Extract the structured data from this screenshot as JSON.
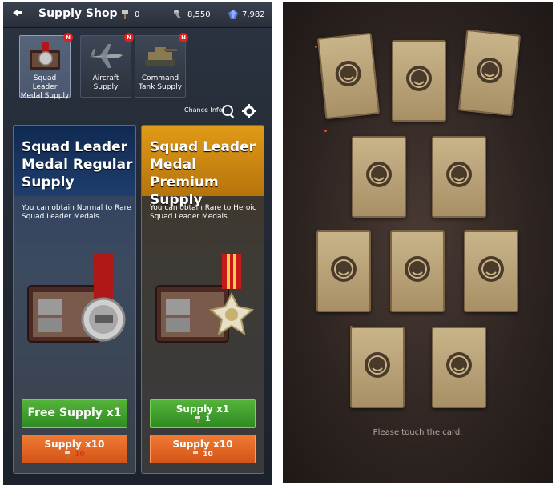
{
  "header": {
    "title": "Supply Shop",
    "resources": [
      {
        "icon": "hammer-icon",
        "value": "0"
      },
      {
        "icon": "wrench-icon",
        "value": "8,550"
      },
      {
        "icon": "gem-icon",
        "value": "7,982"
      }
    ]
  },
  "tabs": [
    {
      "label": "Squad Leader\nMedal Supply",
      "badge": "N",
      "icon": "medal-case-icon"
    },
    {
      "label": "Aircraft\nSupply",
      "badge": "N",
      "icon": "aircraft-icon"
    },
    {
      "label": "Command\nTank Supply",
      "badge": "N",
      "icon": "tank-icon"
    }
  ],
  "chance_info": "Chance Info",
  "cards": {
    "regular": {
      "title": "Squad Leader Medal Regular Supply",
      "description": "You can obtain Normal to Rare Squad Leader Medals.",
      "free_label": "Free Supply x1",
      "x10_label": "Supply x10",
      "x10_cost": "10"
    },
    "premium": {
      "title": "Squad Leader Medal Premium Supply",
      "description": "You can obtain Rare to Heroic Squad Leader Medals.",
      "x1_label": "Supply x1",
      "x1_cost": "1",
      "x10_label": "Supply x10",
      "x10_cost": "10"
    }
  },
  "card_select": {
    "prompt": "Please touch the card."
  },
  "colors": {
    "green_button": "#3f9e2c",
    "orange_button": "#e2662a",
    "badge_red": "#e01f1f"
  }
}
